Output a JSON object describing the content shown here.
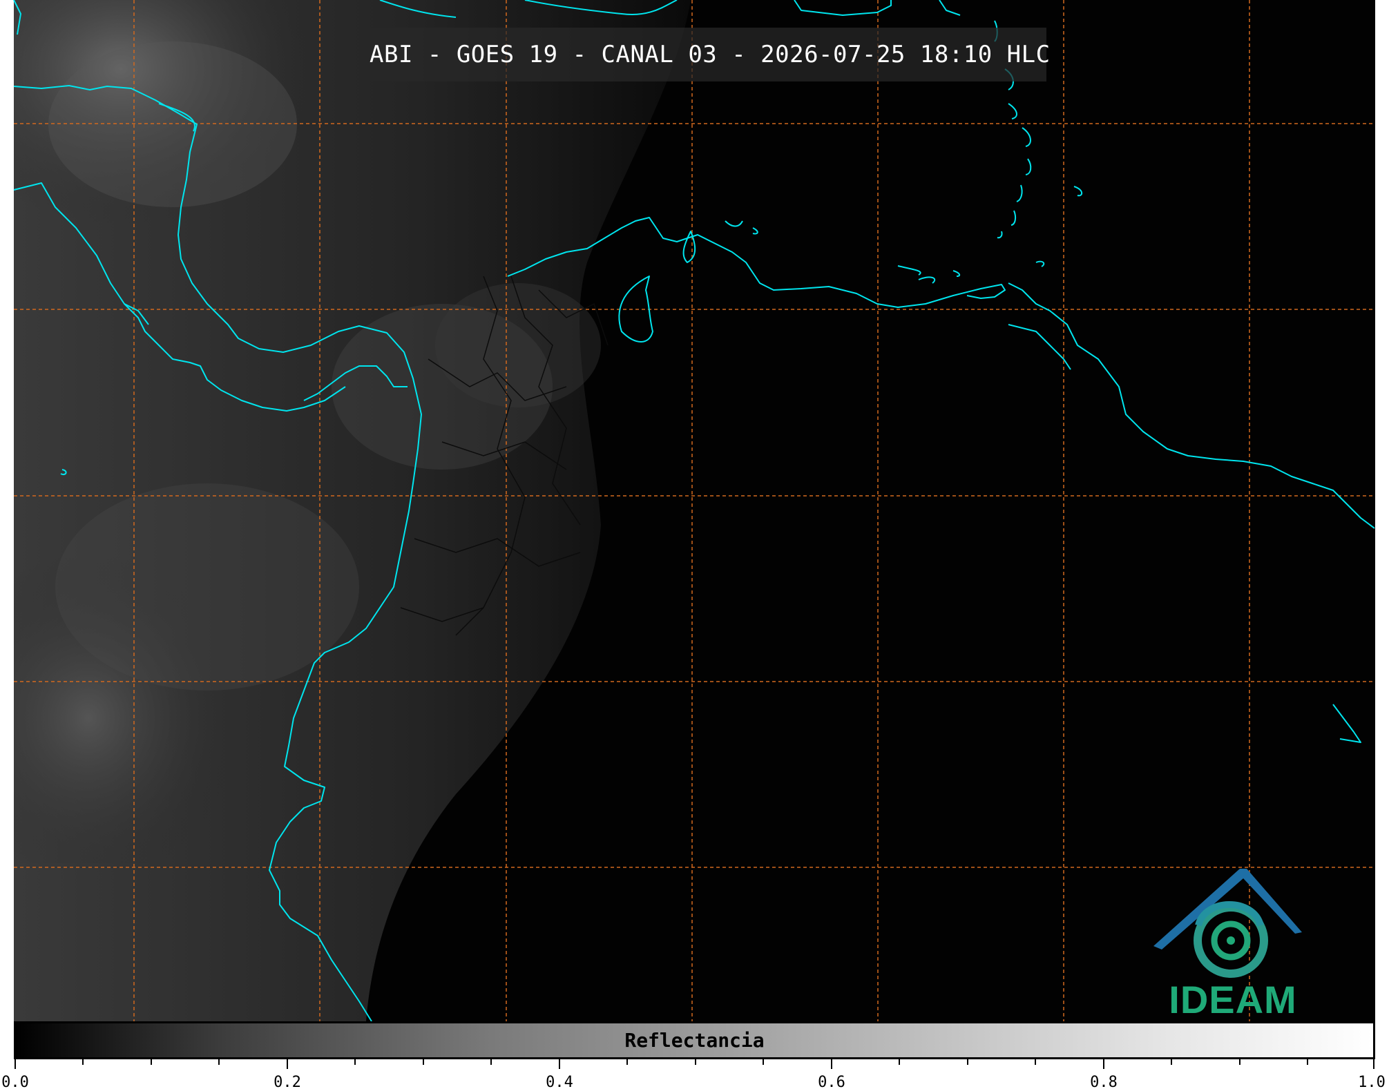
{
  "title": "ABI - GOES 19 - CANAL 03 - 2026-07-25 18:10 HLC",
  "colorbar": {
    "label": "Reflectancia",
    "ticks": [
      "0.0",
      "0.2",
      "0.4",
      "0.6",
      "0.8",
      "1.0"
    ],
    "range": [
      0.0,
      1.0
    ]
  },
  "logo": {
    "text": "IDEAM"
  },
  "colors": {
    "coastline": "#00e5ee",
    "grid": "#d2691e",
    "borders": "#111111"
  }
}
